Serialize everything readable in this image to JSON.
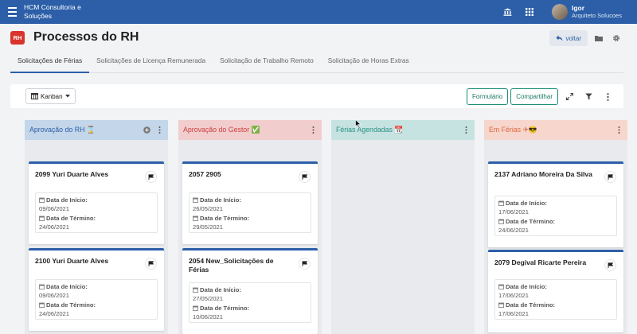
{
  "topbar": {
    "brand": "HCM Consultoria e Soluções",
    "icons": [
      "bank-icon",
      "grid-icon"
    ],
    "user_name": "Igor",
    "user_role": "Arquiteto Solucoes",
    "bar_color": "#2c5fa8"
  },
  "header": {
    "badge": "RH",
    "title": "Processos do RH",
    "back_label": "voltar",
    "icons": [
      "folder-icon",
      "gear-icon"
    ]
  },
  "tabs": [
    {
      "label": "Solicitações de Férias",
      "active": true
    },
    {
      "label": "Solicitações de Licença Remunerada",
      "active": false
    },
    {
      "label": "Solicitação de Trabalho Remoto",
      "active": false
    },
    {
      "label": "Solicitação de Horas Extras",
      "active": false
    }
  ],
  "toolbar": {
    "view_label": "Kanban",
    "form_label": "Formulário",
    "share_label": "Compartilhar",
    "icons": [
      "expand-icon",
      "filter-icon",
      "more-vertical-icon"
    ]
  },
  "date_labels": {
    "start": "Data de Início:",
    "end": "Data de Término:"
  },
  "columns": [
    {
      "title": "Aprovação do RH ⌛",
      "header_bg": "#c3d6ea",
      "title_color": "#2c5fa8",
      "has_add": true,
      "cards": [
        {
          "title": "2099 Yuri Duarte Alves",
          "start": "09/06/2021",
          "end": "24/06/2021"
        },
        {
          "title": "2100 Yuri Duarte Alves",
          "start": "09/06/2021",
          "end": "24/06/2021"
        }
      ]
    },
    {
      "title": "Aprovação do Gestor ✅",
      "header_bg": "#f2cdcd",
      "title_color": "#cc3f3f",
      "has_add": false,
      "cards": [
        {
          "title": "2057 2905",
          "start": "26/05/2021",
          "end": "29/05/2021"
        },
        {
          "title": "2054 New_Solicitações de Férias",
          "start": "27/05/2021",
          "end": "10/06/2021"
        }
      ]
    },
    {
      "title": "Férias Agendadas 📆",
      "header_bg": "#c6e3e1",
      "title_color": "#2a9185",
      "has_add": false,
      "cards": []
    },
    {
      "title": "Em Férias ✈😎",
      "header_bg": "#f6d6cd",
      "title_color": "#e0663f",
      "has_add": false,
      "cards": [
        {
          "title": "2137 Adriano Moreira Da Silva",
          "start": "17/06/2021",
          "end": "24/06/2021"
        },
        {
          "title": "2079 Degival Ricarte Pereira",
          "start": "17/06/2021",
          "end": "17/06/2021"
        }
      ]
    }
  ]
}
